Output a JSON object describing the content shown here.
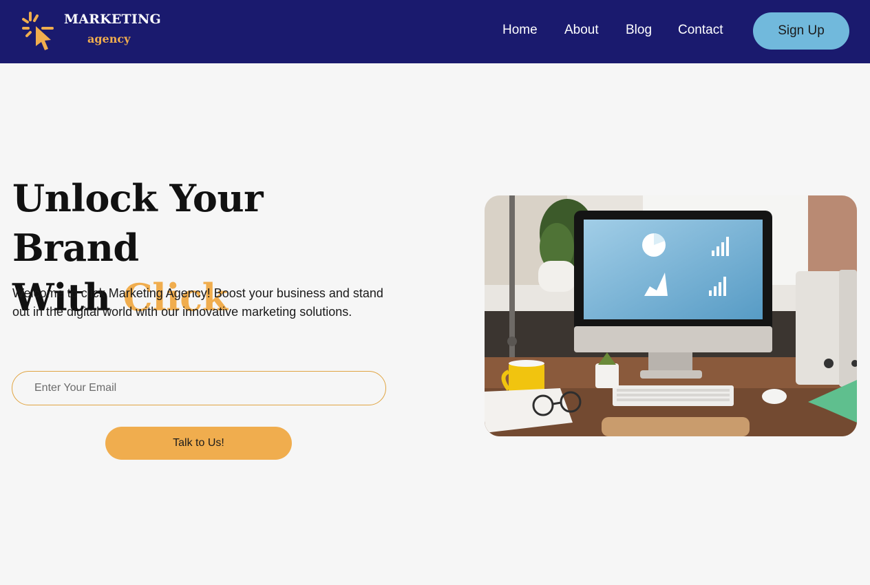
{
  "brand": {
    "title": "MARKETING",
    "subtitle": "agency",
    "icon": "cursor-click-icon"
  },
  "nav": {
    "links": [
      {
        "label": "Home"
      },
      {
        "label": "About"
      },
      {
        "label": "Blog"
      },
      {
        "label": "Contact"
      }
    ],
    "signup_label": "Sign Up"
  },
  "hero": {
    "headline_line1": "Unlock Your Brand",
    "headline_line2_prefix": "With",
    "headline_accent": "Click",
    "description": "Welcome to click Marketing Agency! Boost your business and stand out in the digital world with our innovative marketing solutions.",
    "email_placeholder": "Enter Your Email",
    "email_value": "",
    "cta_label": "Talk to Us!",
    "image": "desk-computer-image"
  },
  "colors": {
    "nav_bg": "#1a1a6e",
    "accent": "#f0ad4e",
    "signup_bg": "#71b9dc",
    "page_bg": "#f6f6f6"
  }
}
